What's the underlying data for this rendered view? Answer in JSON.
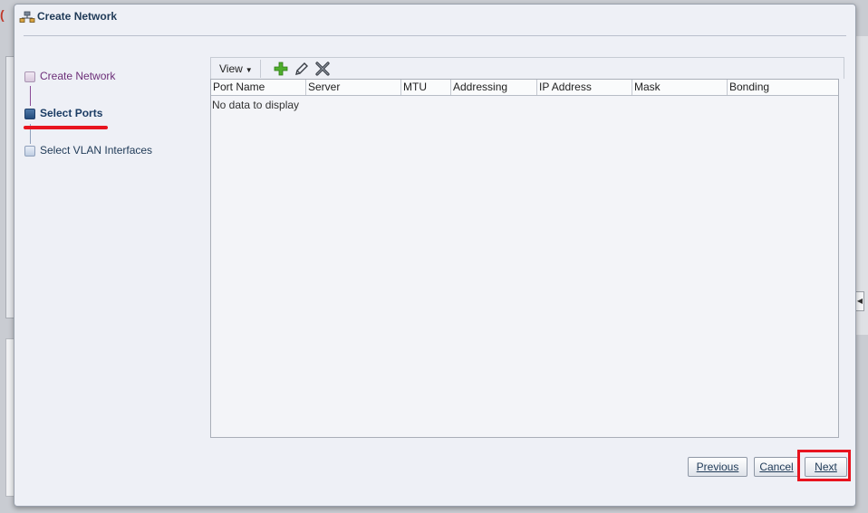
{
  "dialog": {
    "title": "Create Network"
  },
  "train": {
    "steps": [
      {
        "label": "Create Network",
        "state": "visited"
      },
      {
        "label": "Select Ports",
        "state": "current"
      },
      {
        "label": "Select VLAN Interfaces",
        "state": "unvisited"
      }
    ]
  },
  "toolbar": {
    "view_label": "View",
    "icons": [
      "add-icon",
      "edit-icon",
      "delete-icon"
    ]
  },
  "table": {
    "columns": [
      "Port Name",
      "Server",
      "MTU",
      "Addressing",
      "IP Address",
      "Mask",
      "Bonding"
    ],
    "rows": [],
    "empty_message": "No data to display"
  },
  "buttons": {
    "previous": "Previous",
    "cancel": "Cancel",
    "next": "Next"
  },
  "colors": {
    "highlight": "#e8141f",
    "current_step": "#244c7d",
    "visited_step": "#6c2e78"
  }
}
